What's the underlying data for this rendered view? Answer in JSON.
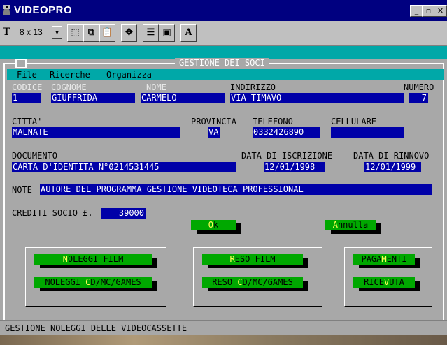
{
  "window": {
    "title": "VIDEOPRO"
  },
  "toolbar": {
    "font_size": "8 x 13"
  },
  "form": {
    "frame_title": "GESTIONE DEI SOCI",
    "menu": [
      "File",
      "Ricerche",
      "Organizza"
    ],
    "labels": {
      "codice": "CODICE",
      "cognome": "COGNOME",
      "nome": "NOME",
      "indirizzo": "INDIRIZZO",
      "numero": "NUMERO",
      "citta": "CITTA'",
      "provincia": "PROVINCIA",
      "telefono": "TELEFONO",
      "cellulare": "CELLULARE",
      "documento": "DOCUMENTO",
      "data_iscrizione": "DATA DI ISCRIZIONE",
      "data_rinnovo": "DATA DI RINNOVO",
      "note": "NOTE",
      "crediti": "CREDITI SOCIO £."
    },
    "values": {
      "codice": "1",
      "cognome": "GIUFFRIDA",
      "nome": "CARMELO",
      "indirizzo": "VIA TIMAVO",
      "numero": "7",
      "citta": "MALNATE",
      "provincia": "VA",
      "telefono": "0332426890",
      "cellulare": "",
      "documento": "CARTA D'IDENTITA N°0214531445",
      "data_iscrizione": "12/01/1998",
      "data_rinnovo": "12/01/1999",
      "note": "AUTORE DEL PROGRAMMA GESTIONE VIDEOTECA PROFESSIONAL",
      "crediti": "39000"
    },
    "buttons": {
      "ok": {
        "pre": "",
        "hot": "O",
        "post": "k"
      },
      "annulla": {
        "pre": "",
        "hot": "A",
        "post": "nnulla"
      },
      "noleggi_film": {
        "pre": "",
        "hot": "N",
        "post": "OLEGGI FILM"
      },
      "noleggi_cd": {
        "pre": "NOLEGGI ",
        "hot": "C",
        "post": "D/MC/GAMES"
      },
      "reso_film": {
        "pre": "",
        "hot": "R",
        "post": "ESO FILM"
      },
      "reso_cd": {
        "pre": "RESO ",
        "hot": "C",
        "post": "D/MC/GAMES"
      },
      "pagamenti": {
        "pre": "PAGA",
        "hot": "M",
        "post": "ENTI"
      },
      "ricevuta": {
        "pre": "RICE",
        "hot": "V",
        "post": "UTA"
      }
    }
  },
  "status": "GESTIONE NOLEGGI DELLE VIDEOCASSETTE",
  "colors": {
    "field_bg": "#0000a8",
    "button_bg": "#00a800",
    "teal": "#00a8a8",
    "dialog_bg": "#a8a8a8"
  }
}
